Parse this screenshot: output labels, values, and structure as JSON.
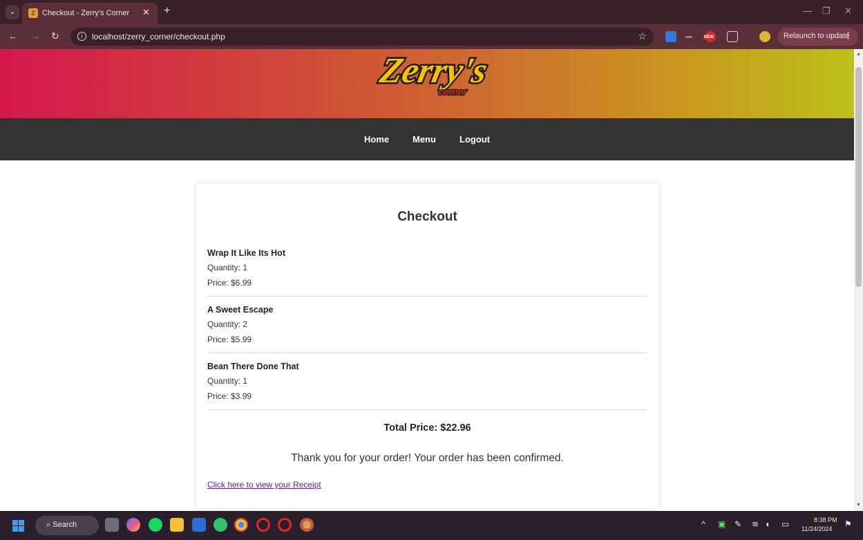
{
  "browser": {
    "tab_title": "Checkout - Zerry's Corner",
    "tab_favicon": "Z",
    "url": "localhost/zerry_corner/checkout.php",
    "relaunch_label": "Relaunch to update",
    "new_badge": "NEW"
  },
  "site": {
    "logo_text": "Zerry's",
    "logo_subtext": "corner",
    "nav": [
      "Home",
      "Menu",
      "Logout"
    ]
  },
  "checkout": {
    "title": "Checkout",
    "items": [
      {
        "name": "Wrap It Like Its Hot",
        "quantity": "Quantity: 1",
        "price": "Price: $6.99"
      },
      {
        "name": "A Sweet Escape",
        "quantity": "Quantity: 2",
        "price": "Price: $5.99"
      },
      {
        "name": "Bean There Done That",
        "quantity": "Quantity: 1",
        "price": "Price: $3.99"
      }
    ],
    "total": "Total Price: $22.96",
    "confirmation": "Thank you for your order! Your order has been confirmed.",
    "receipt_link": "Click here to view your Receipt"
  },
  "taskbar": {
    "search_label": "Search",
    "time": "8:38 PM",
    "date": "11/24/2024"
  },
  "colors": {
    "banner_start": "#d5174d",
    "banner_end": "#bdc01a",
    "navbar": "#333333",
    "browser_frame": "#5a2f39",
    "link_visited": "#5a1e8a"
  }
}
